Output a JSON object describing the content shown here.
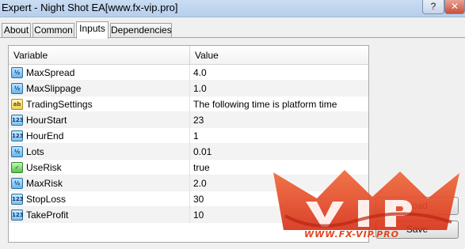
{
  "window": {
    "title": "Expert - Night Shot EA[www.fx-vip.pro]",
    "help_label": "?",
    "close_label": "✕"
  },
  "tabs": [
    {
      "label": "About",
      "active": false
    },
    {
      "label": "Common",
      "active": false
    },
    {
      "label": "Inputs",
      "active": true
    },
    {
      "label": "Dependencies",
      "active": false
    }
  ],
  "grid": {
    "headers": {
      "variable": "Variable",
      "value": "Value"
    },
    "rows": [
      {
        "variable": "MaxSpread",
        "value": "4.0",
        "type_icon": "double-type-icon",
        "icon_text": "½"
      },
      {
        "variable": "MaxSlippage",
        "value": "1.0",
        "type_icon": "double-type-icon",
        "icon_text": "½"
      },
      {
        "variable": "TradingSettings",
        "value": "The following time is platform time",
        "type_icon": "string-type-icon",
        "icon_text": "ab"
      },
      {
        "variable": "HourStart",
        "value": "23",
        "type_icon": "integer-type-icon",
        "icon_text": "123"
      },
      {
        "variable": "HourEnd",
        "value": "1",
        "type_icon": "integer-type-icon",
        "icon_text": "123"
      },
      {
        "variable": "Lots",
        "value": "0.01",
        "type_icon": "double-type-icon",
        "icon_text": "½"
      },
      {
        "variable": "UseRisk",
        "value": "true",
        "type_icon": "boolean-type-icon",
        "icon_text": "✓"
      },
      {
        "variable": "MaxRisk",
        "value": "2.0",
        "type_icon": "double-type-icon",
        "icon_text": "½"
      },
      {
        "variable": "StopLoss",
        "value": "30",
        "type_icon": "integer-type-icon",
        "icon_text": "123"
      },
      {
        "variable": "TakeProfit",
        "value": "10",
        "type_icon": "integer-type-icon",
        "icon_text": "123"
      }
    ]
  },
  "buttons": {
    "load": "Load",
    "save": "Save"
  },
  "watermark": {
    "url_text": "WWW.FX-VIP.PRO",
    "logo_letters": "VIP",
    "color": "#e2451f"
  }
}
